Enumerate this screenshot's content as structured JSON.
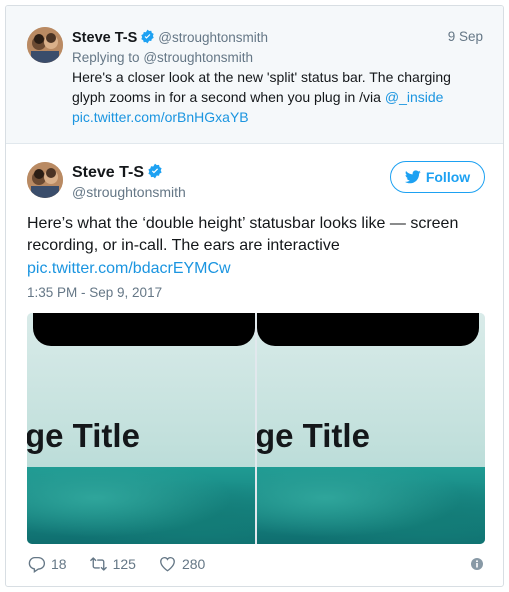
{
  "parent_tweet": {
    "name": "Steve T-S",
    "handle": "@stroughtonsmith",
    "date": "9 Sep",
    "replying_prefix": "Replying to",
    "replying_handle": "@stroughtonsmith",
    "text": "Here's a closer look at the new 'split' status bar. The charging glyph zooms in for a second when you plug in /via ",
    "mention": "@_inside",
    "link": "pic.twitter.com/orBnHGxaYB"
  },
  "tweet": {
    "name": "Steve T-S",
    "handle": "@stroughtonsmith",
    "follow_label": "Follow",
    "text": "Here’s what the ‘double height’ statusbar looks like — screen recording, or in-call. The ears are interactive",
    "link": "pic.twitter.com/bdacrEYMCw",
    "timestamp": "1:35 PM - Sep 9, 2017",
    "media": {
      "left_title": "ge Title",
      "right_title": "ge Title"
    },
    "actions": {
      "replies": "18",
      "retweets": "125",
      "likes": "280"
    }
  },
  "colors": {
    "accent": "#1da1f2",
    "link": "#1b95e0",
    "muted": "#657786"
  },
  "icons": [
    "verified-badge-icon",
    "twitter-bird-icon",
    "reply-icon",
    "retweet-icon",
    "like-icon",
    "info-icon"
  ]
}
